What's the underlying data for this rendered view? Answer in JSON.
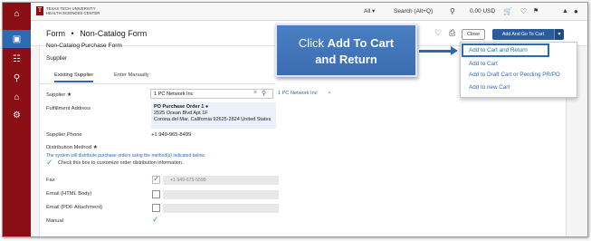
{
  "rail": {
    "icons": [
      "home-icon",
      "cart-icon",
      "documents-icon",
      "vendor-icon",
      "bank-icon",
      "settings-icon"
    ]
  },
  "topbar": {
    "logo_line1": "Texas Tech University",
    "logo_line2": "Health Sciences Center",
    "scope": "All",
    "search_label": "Search (Alt+Q)",
    "cart_amount": "0.00 USD"
  },
  "header": {
    "breadcrumb_root": "Form",
    "breadcrumb_separator": "•",
    "breadcrumb_current": "Non-Catalog Form",
    "close_label": "Close",
    "primary_label": "Add And Go To Cart"
  },
  "form": {
    "section_title": "Non-Catalog Purchase Form",
    "supplier_heading": "Supplier",
    "tabs": [
      "Existing Supplier",
      "Enter Manually"
    ],
    "supplier_label": "Supplier",
    "required_mark": "★",
    "supplier_value": "1 PC Network Inc",
    "supplier_chip": "1 PC Network Inc",
    "fulfillment_label": "Fulfillment Address",
    "address_line1": "PO Purchase Order 1",
    "address_line2": "2525 Ocean Blvd Apt 1F",
    "address_line3": "Corona del Mar, California 92625-2824 United States",
    "phone_label": "Supplier Phone",
    "phone_value": "+1 949-965-8499",
    "distribution_label": "Distribution Method",
    "distribution_note": "The system will distribute purchase orders using the method(s) indicated below.",
    "customize_label": "Check this box to customize order distribution information.",
    "fax_label": "Fax",
    "fax_value": "+1 949-675-5599",
    "email_html_label": "Email (HTML Body)",
    "email_pdf_label": "Email (PDF Attachment)",
    "manual_label": "Manual"
  },
  "menu": {
    "items": [
      "Add to Cart and Return",
      "Add to Cart",
      "Add to Draft Cart or Pending PR/PO",
      "Add to new Cart"
    ]
  },
  "callout": {
    "prefix": "Click ",
    "bold": "Add To Cart",
    "line2": "and Return"
  },
  "colors": {
    "rail": "#8b0e14",
    "accent": "#2c6ab1",
    "primary_button": "#2c5c9c",
    "check": "#3aa44a"
  }
}
